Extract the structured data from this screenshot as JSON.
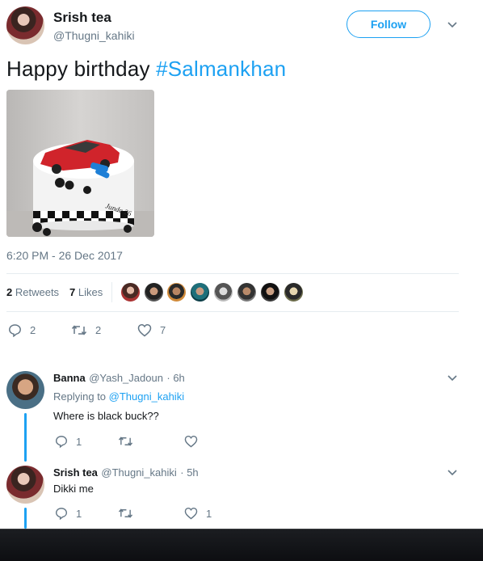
{
  "author": {
    "name": "Srish tea",
    "handle": "@Thugni_kahiki"
  },
  "follow_label": "Follow",
  "tweet": {
    "text": "Happy birthday ",
    "hashtag": "#Salmankhan",
    "cake_text": "Junda 26",
    "timestamp": "6:20 PM - 26 Dec 2017"
  },
  "stats": {
    "retweets_count": "2",
    "retweets_label": "Retweets",
    "likes_count": "7",
    "likes_label": "Likes"
  },
  "actions": {
    "reply_count": "2",
    "retweet_count": "2",
    "like_count": "7"
  },
  "replies": [
    {
      "name": "Banna",
      "handle": "@Yash_Jadoun",
      "time": "· 6h",
      "replying_prefix": "Replying to",
      "replying_to": "@Thugni_kahiki",
      "text": "Where is black buck??",
      "reply_count": "1",
      "retweet_count": "",
      "like_count": ""
    },
    {
      "name": "Srish tea",
      "handle": "@Thugni_kahiki",
      "time": "· 5h",
      "text": "Dikki me",
      "reply_count": "1",
      "retweet_count": "",
      "like_count": "1"
    }
  ],
  "colors": {
    "accent": "#1da1f2",
    "muted": "#657786",
    "text": "#14171a"
  }
}
